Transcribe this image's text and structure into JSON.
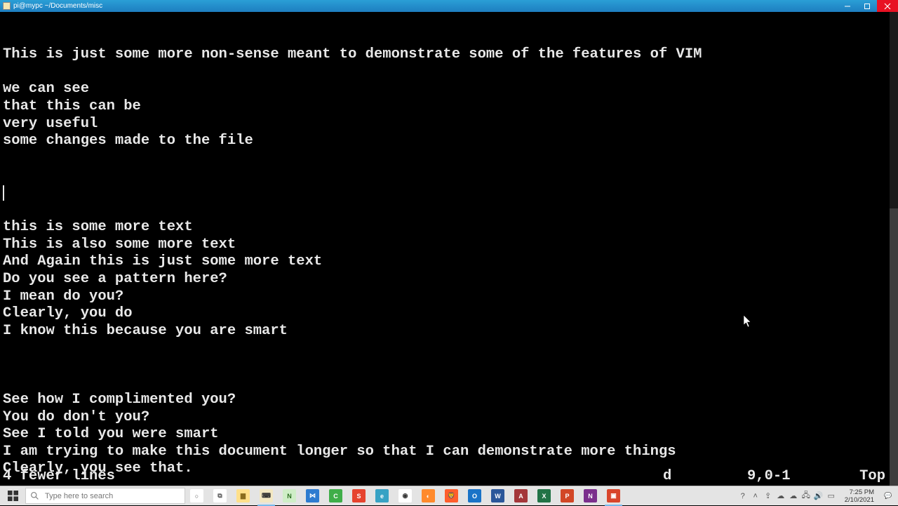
{
  "window": {
    "title": "pi@mypc ~/Documents/misc"
  },
  "editor": {
    "lines": [
      "This is just some more non-sense meant to demonstrate some of the features of VIM",
      "",
      "we can see",
      "that this can be",
      "very useful",
      "some changes made to the file",
      "",
      "",
      "",
      "",
      "this is some more text",
      "This is also some more text",
      "And Again this is just some more text",
      "Do you see a pattern here?",
      "I mean do you?",
      "Clearly, you do",
      "I know this because you are smart",
      "",
      "",
      "",
      "See how I complimented you?",
      "You do don't you?",
      "See I told you were smart",
      "I am trying to make this document longer so that I can demonstrate more things",
      "Clearly, you see that."
    ],
    "cursor_line_index": 8,
    "status": {
      "message": "4 fewer lines",
      "register": "d",
      "position": "9,0-1",
      "scroll": "Top"
    }
  },
  "taskbar": {
    "search_placeholder": "Type here to search",
    "apps": [
      {
        "name": "cortana",
        "bg": "#ffffff",
        "fg": "#555",
        "glyph": "○"
      },
      {
        "name": "taskview",
        "bg": "#ffffff",
        "fg": "#555",
        "glyph": "⧉"
      },
      {
        "name": "file-explorer",
        "bg": "#ffe08a",
        "fg": "#8a6d1e",
        "glyph": "▆"
      },
      {
        "name": "putty",
        "bg": "#f3e7c1",
        "fg": "#333",
        "glyph": "⌨",
        "active": true
      },
      {
        "name": "notepadpp",
        "bg": "#cfeec7",
        "fg": "#2b6e1f",
        "glyph": "N"
      },
      {
        "name": "vscode",
        "bg": "#2d7bd0",
        "fg": "#fff",
        "glyph": "⋈"
      },
      {
        "name": "camtasia",
        "bg": "#3fae49",
        "fg": "#fff",
        "glyph": "C"
      },
      {
        "name": "wps",
        "bg": "#e6432e",
        "fg": "#fff",
        "glyph": "S"
      },
      {
        "name": "edge",
        "bg": "#37a2c4",
        "fg": "#fff",
        "glyph": "e"
      },
      {
        "name": "chrome",
        "bg": "#ffffff",
        "fg": "#333",
        "glyph": "◉"
      },
      {
        "name": "firefox",
        "bg": "#ff8a2c",
        "fg": "#fff",
        "glyph": "◐"
      },
      {
        "name": "brave",
        "bg": "#ff5d2c",
        "fg": "#fff",
        "glyph": "🦁"
      },
      {
        "name": "outlook",
        "bg": "#1a73c7",
        "fg": "#fff",
        "glyph": "O"
      },
      {
        "name": "word",
        "bg": "#2b579a",
        "fg": "#fff",
        "glyph": "W"
      },
      {
        "name": "access",
        "bg": "#a4373a",
        "fg": "#fff",
        "glyph": "A"
      },
      {
        "name": "excel",
        "bg": "#217346",
        "fg": "#fff",
        "glyph": "X"
      },
      {
        "name": "powerpoint",
        "bg": "#d24726",
        "fg": "#fff",
        "glyph": "P"
      },
      {
        "name": "onenote",
        "bg": "#7b2f8c",
        "fg": "#fff",
        "glyph": "N"
      },
      {
        "name": "snagit",
        "bg": "#d9452b",
        "fg": "#fff",
        "glyph": "▣",
        "active": true
      }
    ],
    "tray": [
      {
        "name": "help-icon",
        "glyph": "?"
      },
      {
        "name": "chevron-up-icon",
        "glyph": "˄"
      },
      {
        "name": "usb-icon",
        "glyph": "⇪"
      },
      {
        "name": "onedrive-icon",
        "glyph": "☁"
      },
      {
        "name": "onedrive2-icon",
        "glyph": "☁"
      },
      {
        "name": "network-icon",
        "glyph": "🖧"
      },
      {
        "name": "volume-icon",
        "glyph": "🔊"
      },
      {
        "name": "battery-icon",
        "glyph": "▭"
      }
    ],
    "clock": {
      "time": "7:25 PM",
      "date": "2/10/2021"
    },
    "notif_glyph": "💬"
  }
}
